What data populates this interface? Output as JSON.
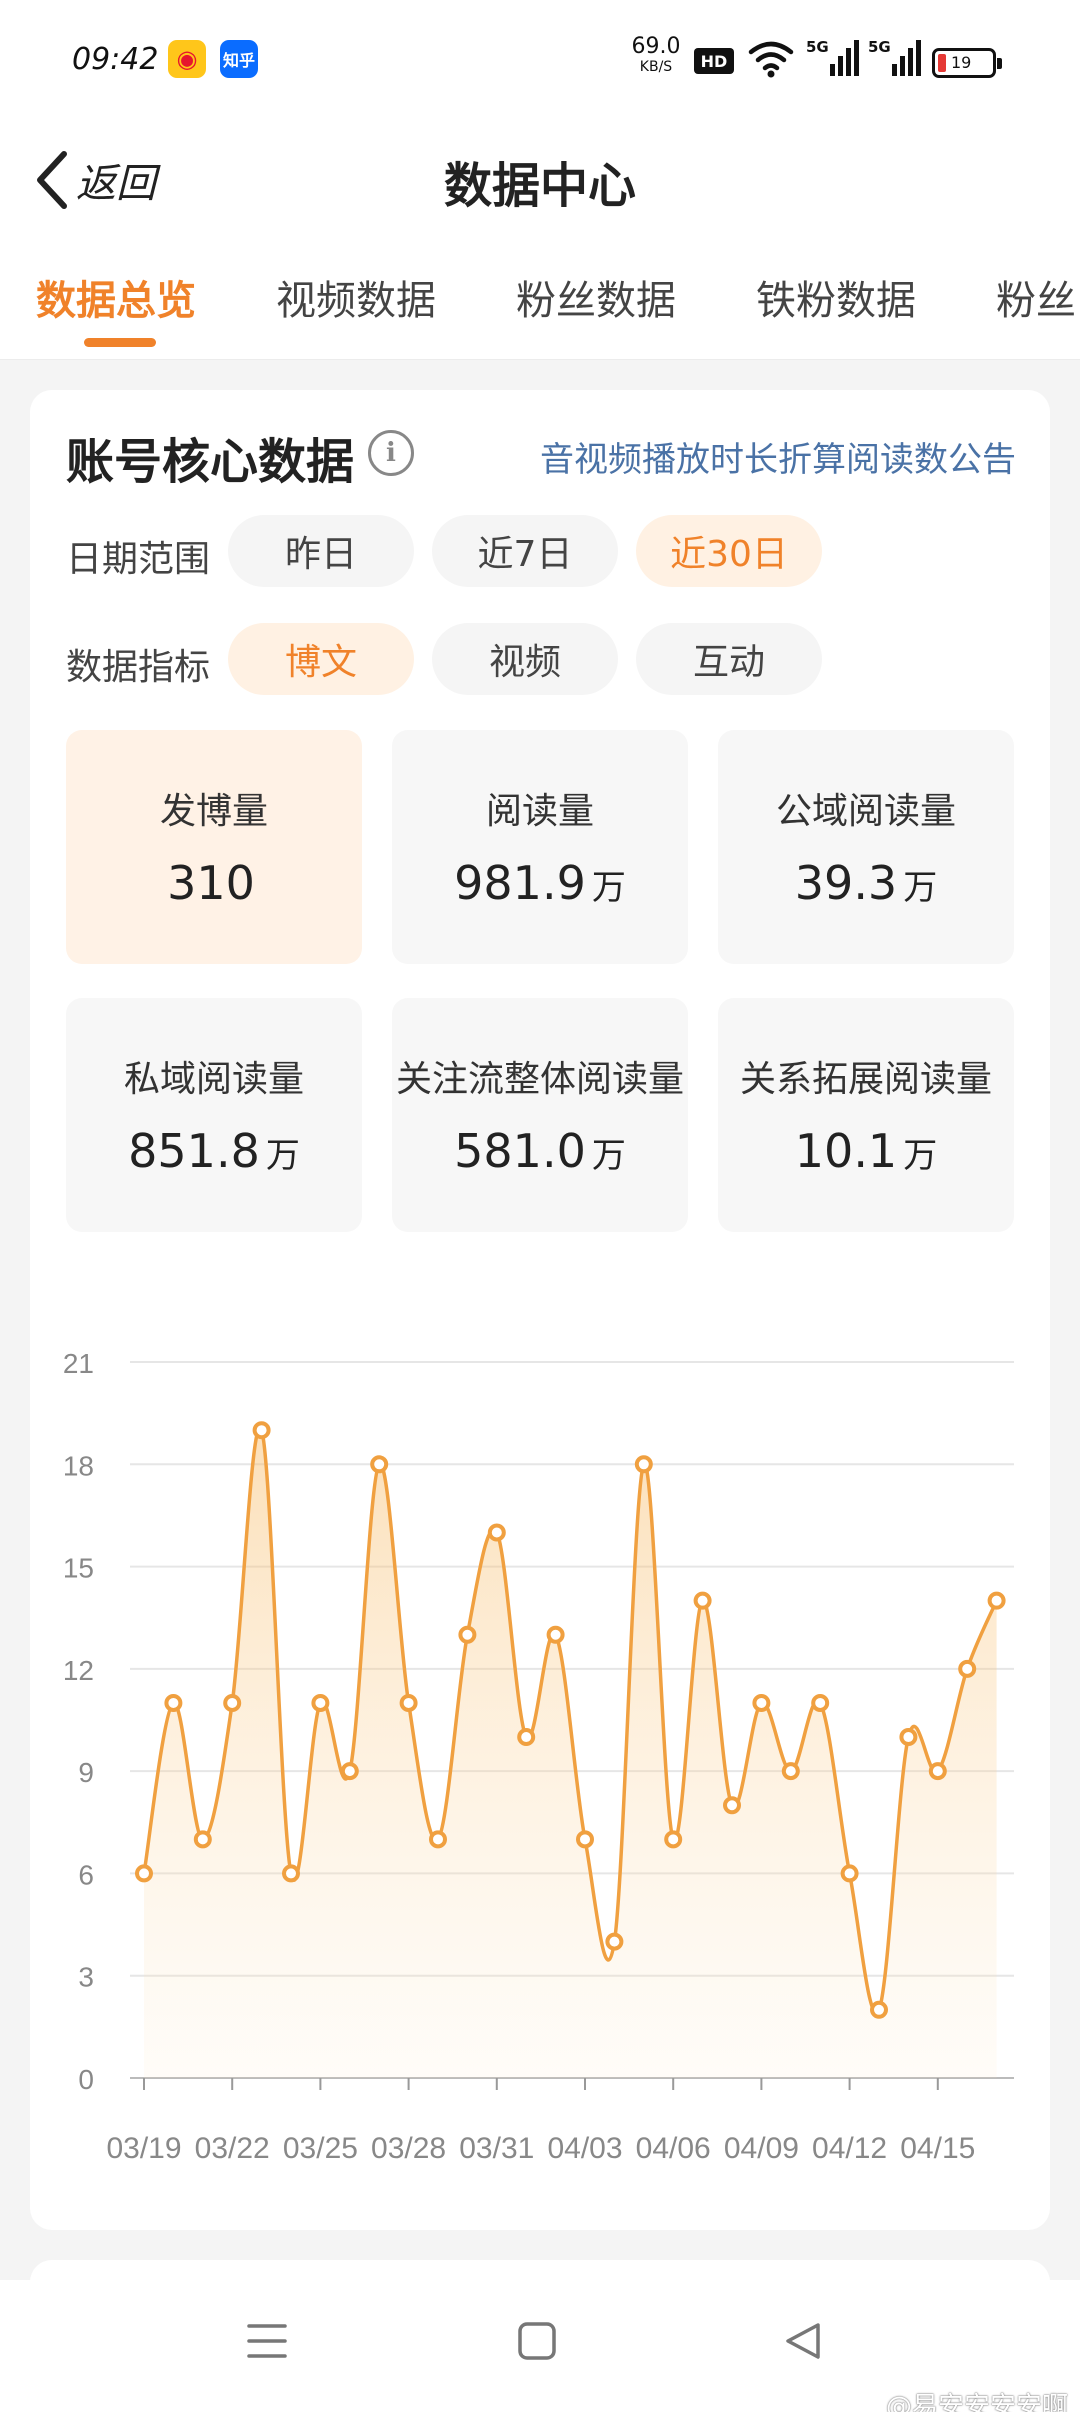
{
  "status_bar": {
    "time": "09:42",
    "zhihu_label": "知乎",
    "net_speed_value": "69.0",
    "net_speed_unit": "KB/S",
    "hd_label": "HD",
    "net_type_1": "5G",
    "net_type_2": "5G",
    "battery_level": "19"
  },
  "nav": {
    "back_label": "返回",
    "title": "数据中心"
  },
  "tabs": [
    "数据总览",
    "视频数据",
    "粉丝数据",
    "铁粉数据",
    "粉丝"
  ],
  "card": {
    "title": "账号核心数据",
    "notice_link": "音视频播放时长折算阅读数公告",
    "date_range": {
      "label": "日期范围",
      "options": [
        "昨日",
        "近7日",
        "近30日"
      ],
      "selected": "近30日"
    },
    "metric_type": {
      "label": "数据指标",
      "options": [
        "博文",
        "视频",
        "互动"
      ],
      "selected": "博文"
    },
    "metrics": [
      {
        "label": "发博量",
        "value": "310",
        "unit": ""
      },
      {
        "label": "阅读量",
        "value": "981.9",
        "unit": "万"
      },
      {
        "label": "公域阅读量",
        "value": "39.3",
        "unit": "万"
      },
      {
        "label": "私域阅读量",
        "value": "851.8",
        "unit": "万"
      },
      {
        "label": "关注流整体阅读量",
        "value": "581.0",
        "unit": "万"
      },
      {
        "label": "关系拓展阅读量",
        "value": "10.1",
        "unit": "万"
      }
    ]
  },
  "chart_data": {
    "type": "area",
    "title": "",
    "xlabel": "",
    "ylabel": "",
    "ylim": [
      0,
      21
    ],
    "yticks": [
      0,
      3,
      6,
      9,
      12,
      15,
      18,
      21
    ],
    "grid": true,
    "x": [
      "03/19",
      "03/20",
      "03/21",
      "03/22",
      "03/23",
      "03/24",
      "03/25",
      "03/26",
      "03/27",
      "03/28",
      "03/29",
      "03/30",
      "03/31",
      "04/01",
      "04/02",
      "04/03",
      "04/04",
      "04/05",
      "04/06",
      "04/07",
      "04/08",
      "04/09",
      "04/10",
      "04/11",
      "04/12",
      "04/13",
      "04/14",
      "04/15",
      "04/16",
      "04/17"
    ],
    "xtick_labels": [
      "03/19",
      "03/22",
      "03/25",
      "03/28",
      "03/31",
      "04/03",
      "04/06",
      "04/09",
      "04/12",
      "04/15"
    ],
    "series": [
      {
        "values": [
          6,
          11,
          7,
          11,
          19,
          6,
          11,
          9,
          18,
          11,
          7,
          13,
          16,
          10,
          13,
          7,
          4,
          18,
          7,
          14,
          8,
          11,
          9,
          11,
          6,
          2,
          10,
          9,
          12,
          14
        ]
      }
    ],
    "color": "#f0a040"
  },
  "system_nav": {
    "watermark": "@易安安安安啊"
  }
}
